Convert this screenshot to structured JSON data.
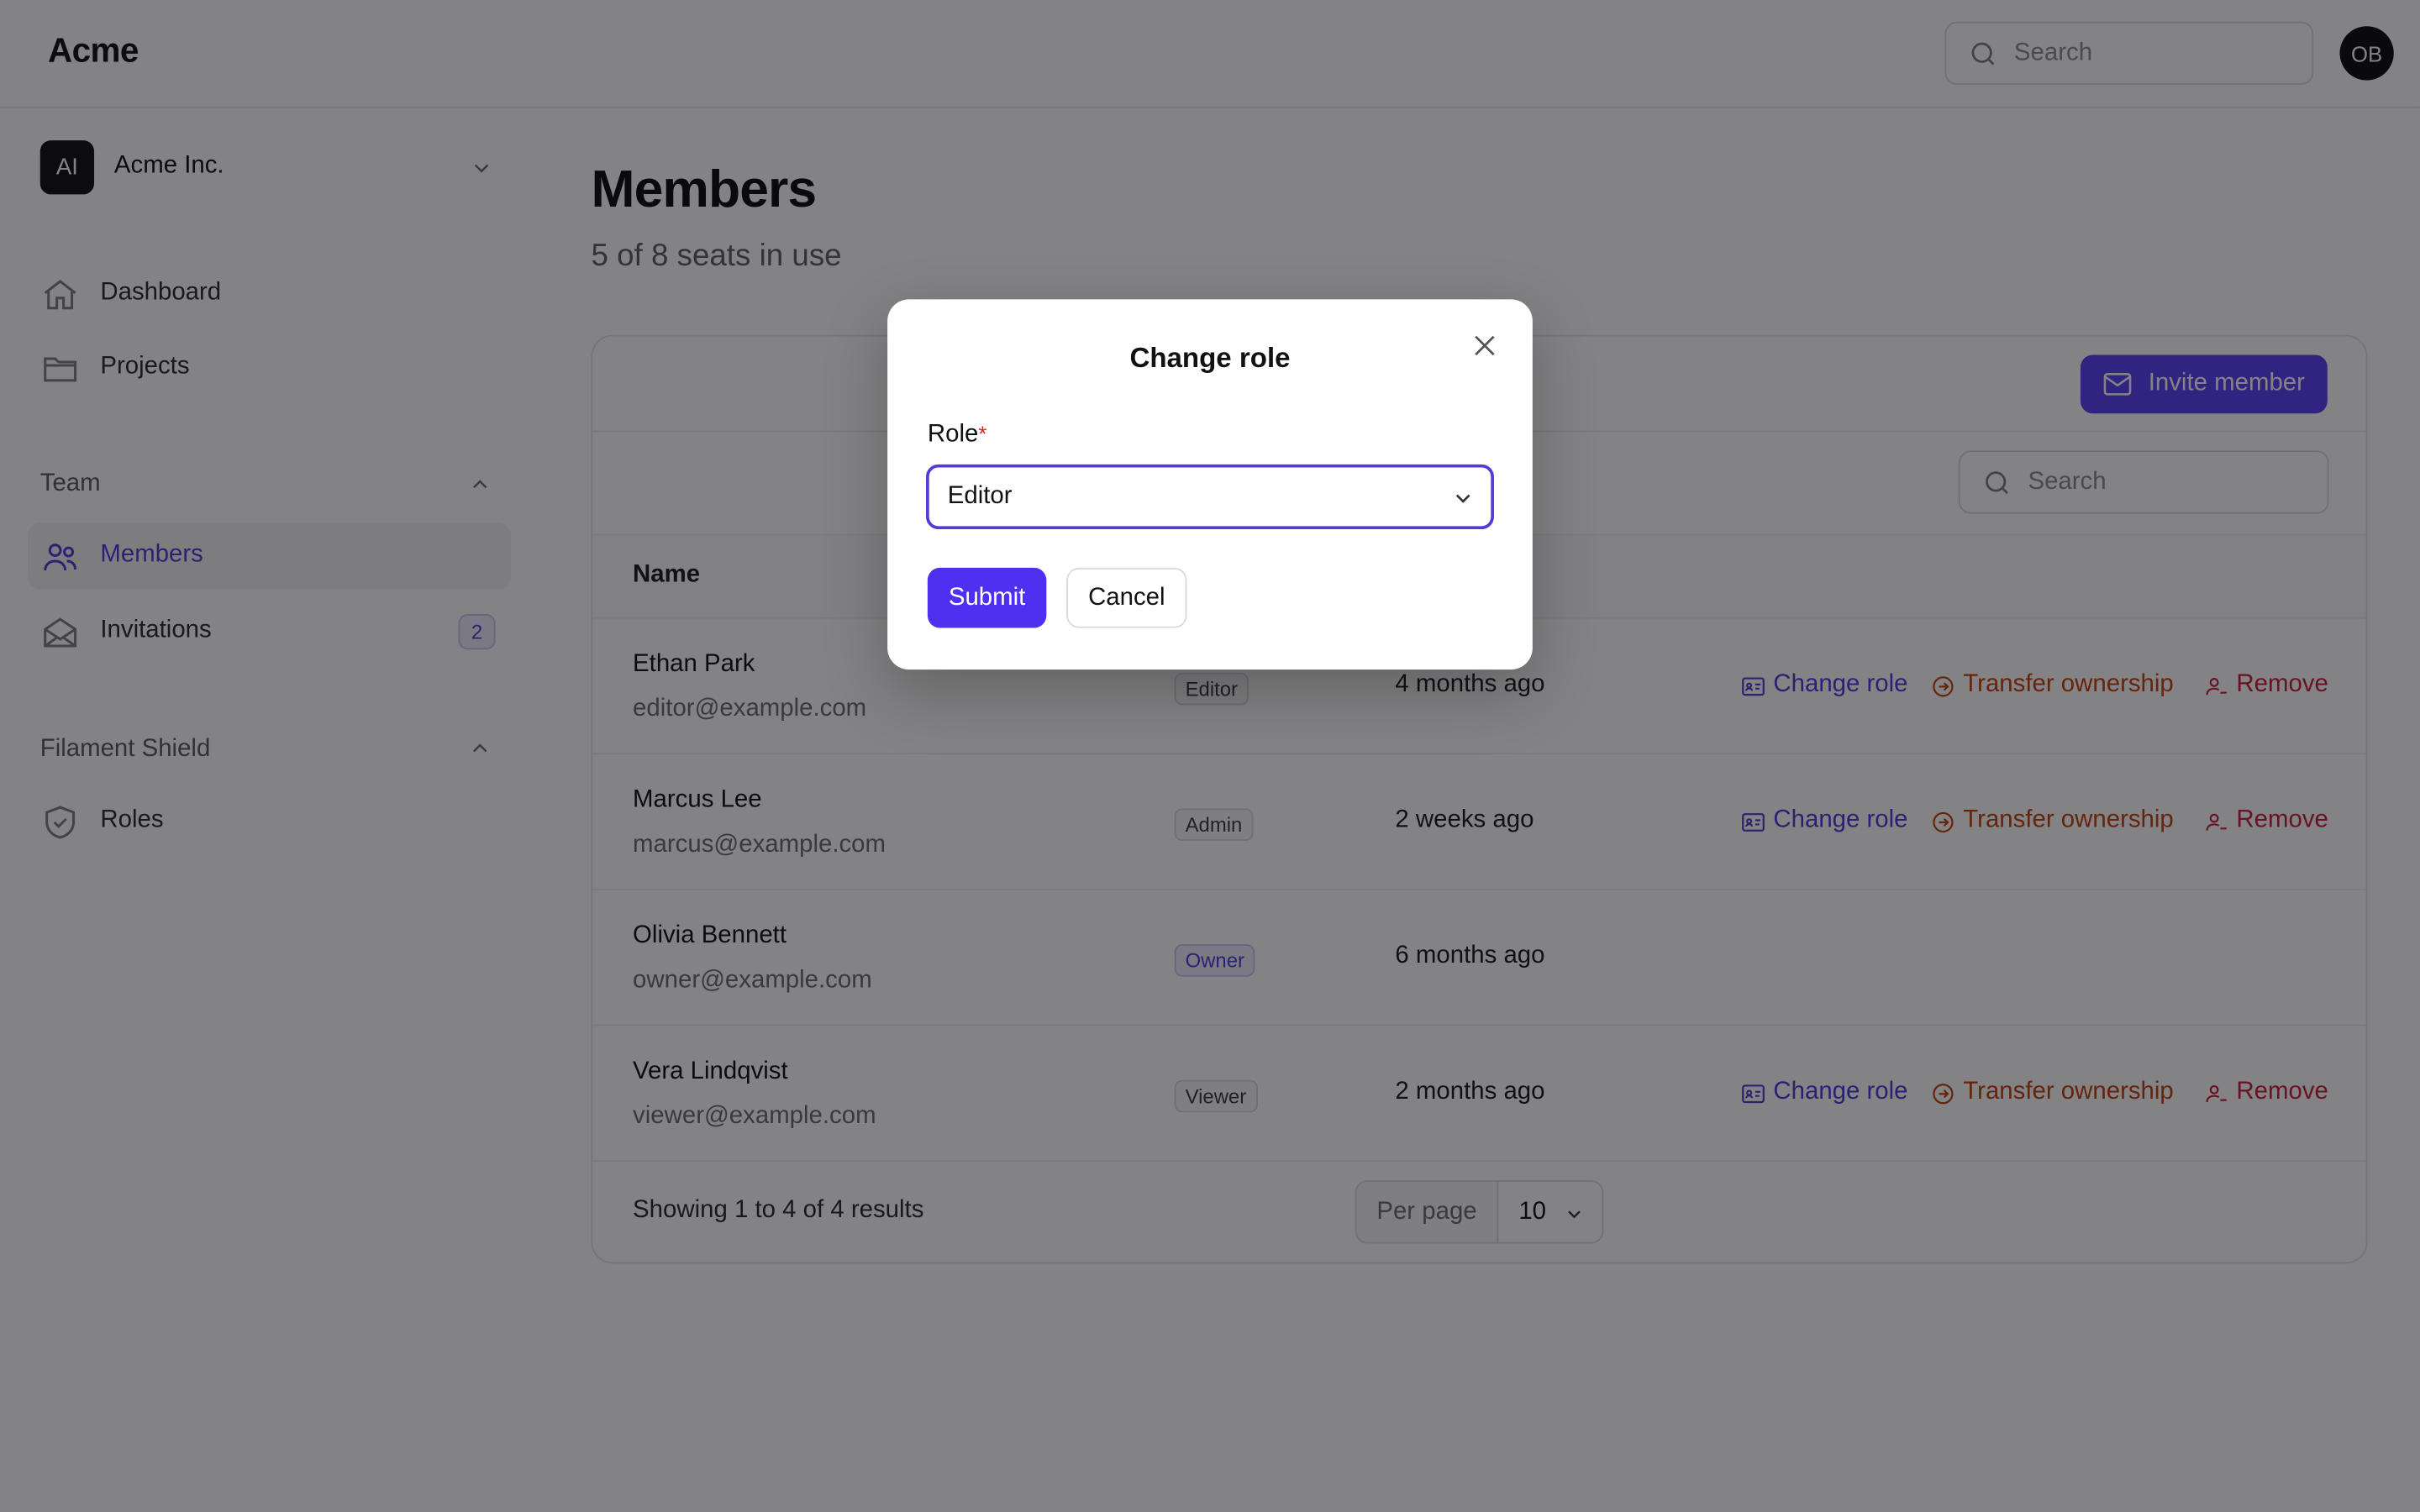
{
  "header": {
    "brand": "Acme",
    "search_placeholder": "Search",
    "avatar_initials": "OB"
  },
  "sidebar": {
    "tenant": {
      "initials": "AI",
      "name": "Acme Inc."
    },
    "items": [
      {
        "label": "Dashboard",
        "icon": "home-icon"
      },
      {
        "label": "Projects",
        "icon": "folder-icon"
      }
    ],
    "groups": [
      {
        "label": "Team",
        "items": [
          {
            "label": "Members",
            "icon": "users-icon",
            "active": true
          },
          {
            "label": "Invitations",
            "icon": "envelope-open-icon",
            "badge": "2"
          }
        ]
      },
      {
        "label": "Filament Shield",
        "items": [
          {
            "label": "Roles",
            "icon": "shield-check-icon"
          }
        ]
      }
    ]
  },
  "main": {
    "title": "Members",
    "subtitle": "5 of 8 seats in use",
    "invite_label": "Invite member",
    "table_search_placeholder": "Search",
    "column_name": "Name",
    "rows": [
      {
        "name": "Ethan Park",
        "email": "editor@example.com",
        "role": "Editor",
        "when": "4 months ago",
        "actions": [
          "Change role",
          "Transfer ownership",
          "Remove"
        ]
      },
      {
        "name": "Marcus Lee",
        "email": "marcus@example.com",
        "role": "Admin",
        "when": "2 weeks ago",
        "actions": [
          "Change role",
          "Transfer ownership",
          "Remove"
        ]
      },
      {
        "name": "Olivia Bennett",
        "email": "owner@example.com",
        "role": "Owner",
        "when": "6 months ago",
        "actions": []
      },
      {
        "name": "Vera Lindqvist",
        "email": "viewer@example.com",
        "role": "Viewer",
        "when": "2 months ago",
        "actions": [
          "Change role",
          "Transfer ownership",
          "Remove"
        ]
      }
    ],
    "footer_info": "Showing 1 to 4 of 4 results",
    "per_page_label": "Per page",
    "per_page_value": "10"
  },
  "modal": {
    "title": "Change role",
    "field_label": "Role",
    "required_mark": "*",
    "selected_value": "Editor",
    "submit_label": "Submit",
    "cancel_label": "Cancel"
  },
  "colors": {
    "accent": "#4f3bd6",
    "primary_button": "#5b3ff5",
    "transfer": "#c2410c",
    "danger": "#c81e3a",
    "overlay": "rgba(8,8,12,0.5)"
  }
}
